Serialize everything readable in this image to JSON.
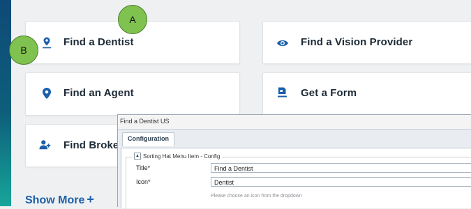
{
  "cards": {
    "dentist": "Find a Dentist",
    "vision": "Find a Vision Provider",
    "agent": "Find an Agent",
    "form": "Get a Form",
    "broker": "Find Broke"
  },
  "show_more": {
    "label": "Show More",
    "plus": "+"
  },
  "annotations": {
    "a": "A",
    "b": "B"
  },
  "dialog": {
    "title": "Find a Dentist US",
    "tab": "Configuration",
    "section": "Sorting Hat Menu Item - Config",
    "toggle": "▲",
    "fields": {
      "title_label": "Title*",
      "title_value": "Find a Dentist",
      "icon_label": "Icon*",
      "icon_value": "Dentist",
      "icon_hint": "Please choose an icon from the dropdown"
    }
  },
  "colors": {
    "brand": "#1b5fa8",
    "stripe": "#0e4a78",
    "badge": "#7fc24f"
  },
  "icons": {
    "dentist": "map-pin-person-icon",
    "vision": "eye-icon",
    "agent": "location-pin-icon",
    "form": "form-icon",
    "broker": "person-add-icon"
  }
}
